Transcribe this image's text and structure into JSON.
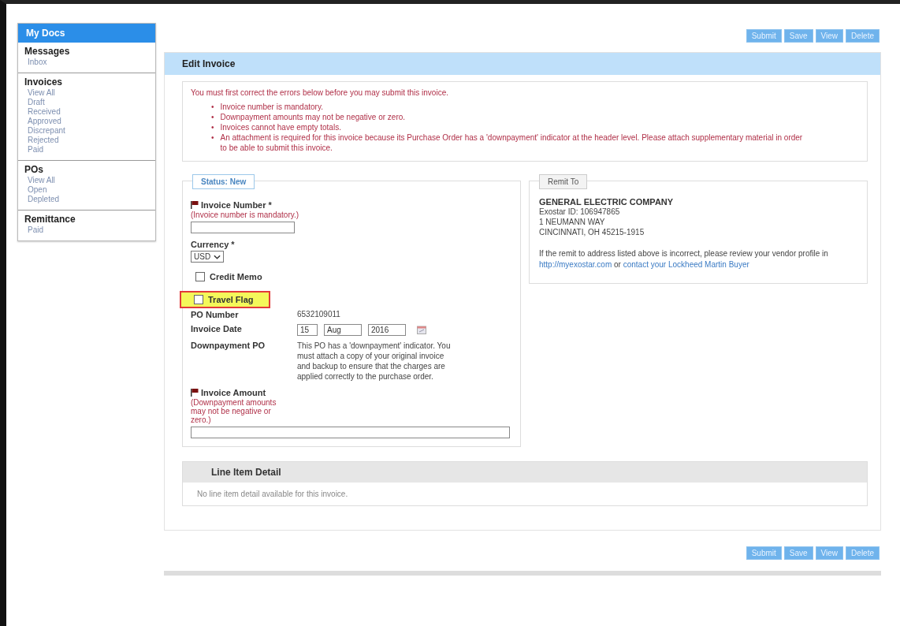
{
  "sidebar": {
    "title": "My Docs",
    "sections": [
      {
        "heading": "Messages",
        "items": [
          "Inbox"
        ]
      },
      {
        "heading": "Invoices",
        "items": [
          "View All",
          "Draft",
          "Received",
          "Approved",
          "Discrepant",
          "Rejected",
          "Paid"
        ]
      },
      {
        "heading": "POs",
        "items": [
          "View All",
          "Open",
          "Depleted"
        ]
      },
      {
        "heading": "Remittance",
        "items": [
          "Paid"
        ]
      }
    ]
  },
  "toolbar_top": [
    "Submit",
    "Save",
    "View",
    "Delete"
  ],
  "panel": {
    "title": "Edit Invoice"
  },
  "errors": {
    "intro": "You must first correct the errors below before you may submit this invoice.",
    "marker": "•",
    "items": [
      "Invoice number is mandatory.",
      "Downpayment amounts may not be negative or zero.",
      "Invoices cannot have empty totals.",
      "An attachment is required for this invoice because its Purchase Order has a 'downpayment' indicator at the header level. Please attach supplementary material in order to be able to submit this invoice."
    ]
  },
  "status": {
    "label": "Status: New"
  },
  "invoice_number": {
    "label": "Invoice Number",
    "required_mark": "*",
    "flagged": true,
    "error": "(Invoice number is mandatory.)"
  },
  "currency": {
    "label": "Currency",
    "required_mark": "*",
    "value": "USD"
  },
  "checkboxes": [
    {
      "label": "Credit Memo",
      "checked": false,
      "highlighted": false
    },
    {
      "label": "Travel Flag",
      "checked": false,
      "highlighted": true
    }
  ],
  "po_number": {
    "label": "PO Number",
    "value": "6532109011"
  },
  "invoice_date": {
    "label": "Invoice Date",
    "day": "15",
    "month": "Aug",
    "year": "2016"
  },
  "downpayment": {
    "label": "Downpayment PO",
    "text": "This PO has a 'downpayment' indicator. You must attach a copy of your original invoice and backup to ensure that the charges are applied correctly to the purchase order."
  },
  "invoice_amount": {
    "label": "Invoice Amount",
    "flagged": true,
    "error": "(Downpayment amounts may not be negative or zero.)"
  },
  "remit": {
    "title": "Remit To",
    "company": "GENERAL ELECTRIC COMPANY",
    "lines": [
      "Exostar ID: 106947865",
      "1 NEUMANN WAY",
      "CINCINNATI, OH   45215-1915"
    ],
    "note": "If the remit to address listed above is incorrect, please review your vendor profile in",
    "link1": "http://myexostar.com",
    "middle": "or",
    "link2": "contact your Lockheed Martin Buyer"
  },
  "line_items": {
    "title": "Line Item Detail",
    "empty_text": "No line item detail available for this invoice."
  },
  "toolbar_bottom": [
    "Submit",
    "Save",
    "View",
    "Delete"
  ]
}
